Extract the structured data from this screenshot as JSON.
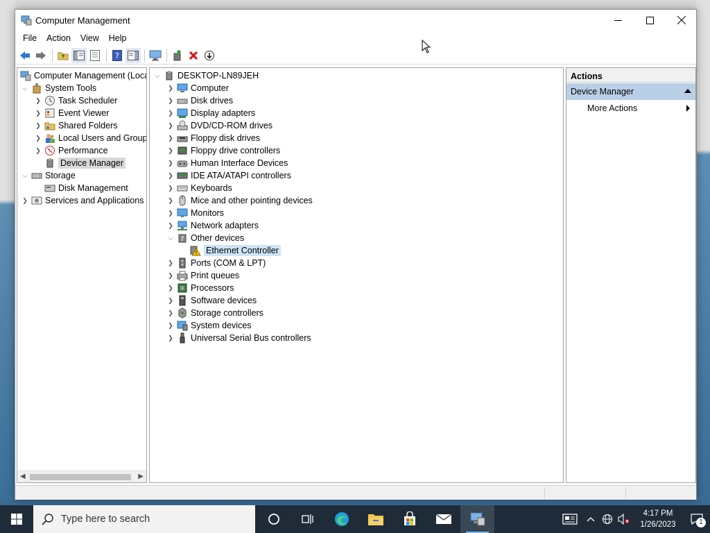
{
  "window": {
    "title": "Computer Management",
    "controls": {
      "minimize": "—",
      "maximize": "☐",
      "close": "✕"
    }
  },
  "menubar": [
    "File",
    "Action",
    "View",
    "Help"
  ],
  "toolbar": {
    "icons": [
      "back-arrow-icon",
      "forward-arrow-icon",
      "up-folder-icon",
      "show-hide-console-tree-icon",
      "properties-icon",
      "help-icon",
      "show-hide-action-pane-icon",
      "monitor-icon",
      "update-driver-icon",
      "uninstall-device-icon",
      "enable-device-icon"
    ]
  },
  "left_tree": [
    {
      "label": "Computer Management (Local",
      "icon": "computer-management-icon",
      "expander": "",
      "indent": 0
    },
    {
      "label": "System Tools",
      "icon": "system-tools-icon",
      "expander": "v",
      "indent": 1
    },
    {
      "label": "Task Scheduler",
      "icon": "clock-icon",
      "expander": ">",
      "indent": 2
    },
    {
      "label": "Event Viewer",
      "icon": "event-viewer-icon",
      "expander": ">",
      "indent": 2
    },
    {
      "label": "Shared Folders",
      "icon": "shared-folder-icon",
      "expander": ">",
      "indent": 2
    },
    {
      "label": "Local Users and Groups",
      "icon": "users-icon",
      "expander": ">",
      "indent": 2
    },
    {
      "label": "Performance",
      "icon": "performance-icon",
      "expander": ">",
      "indent": 2
    },
    {
      "label": "Device Manager",
      "icon": "device-manager-icon",
      "expander": "",
      "indent": 2,
      "selected": true
    },
    {
      "label": "Storage",
      "icon": "storage-icon",
      "expander": "v",
      "indent": 1
    },
    {
      "label": "Disk Management",
      "icon": "disk-management-icon",
      "expander": "",
      "indent": 2
    },
    {
      "label": "Services and Applications",
      "icon": "services-icon",
      "expander": ">",
      "indent": 1
    }
  ],
  "device_tree": {
    "root": "DESKTOP-LN89JEH",
    "items": [
      {
        "label": "Computer",
        "icon": "computer-icon",
        "expander": ">"
      },
      {
        "label": "Disk drives",
        "icon": "disk-drive-icon",
        "expander": ">"
      },
      {
        "label": "Display adapters",
        "icon": "display-adapter-icon",
        "expander": ">"
      },
      {
        "label": "DVD/CD-ROM drives",
        "icon": "dvd-drive-icon",
        "expander": ">"
      },
      {
        "label": "Floppy disk drives",
        "icon": "floppy-icon",
        "expander": ">"
      },
      {
        "label": "Floppy drive controllers",
        "icon": "floppy-controller-icon",
        "expander": ">"
      },
      {
        "label": "Human Interface Devices",
        "icon": "hid-icon",
        "expander": ">"
      },
      {
        "label": "IDE ATA/ATAPI controllers",
        "icon": "ide-controller-icon",
        "expander": ">"
      },
      {
        "label": "Keyboards",
        "icon": "keyboard-icon",
        "expander": ">"
      },
      {
        "label": "Mice and other pointing devices",
        "icon": "mouse-icon",
        "expander": ">"
      },
      {
        "label": "Monitors",
        "icon": "monitor-icon",
        "expander": ">"
      },
      {
        "label": "Network adapters",
        "icon": "network-adapter-icon",
        "expander": ">"
      },
      {
        "label": "Other devices",
        "icon": "unknown-device-icon",
        "expander": "v"
      },
      {
        "label": "Ethernet Controller",
        "icon": "warning-device-icon",
        "expander": "",
        "child": true,
        "selected": true
      },
      {
        "label": "Ports (COM & LPT)",
        "icon": "port-icon",
        "expander": ">"
      },
      {
        "label": "Print queues",
        "icon": "printer-icon",
        "expander": ">"
      },
      {
        "label": "Processors",
        "icon": "processor-icon",
        "expander": ">"
      },
      {
        "label": "Software devices",
        "icon": "software-device-icon",
        "expander": ">"
      },
      {
        "label": "Storage controllers",
        "icon": "storage-controller-icon",
        "expander": ">"
      },
      {
        "label": "System devices",
        "icon": "system-device-icon",
        "expander": ">"
      },
      {
        "label": "Universal Serial Bus controllers",
        "icon": "usb-icon",
        "expander": ">"
      }
    ]
  },
  "actions": {
    "header": "Actions",
    "section": "Device Manager",
    "more": "More Actions"
  },
  "taskbar": {
    "search_placeholder": "Type here to search",
    "time": "4:17 PM",
    "date": "1/26/2023",
    "notification_count": "1"
  }
}
